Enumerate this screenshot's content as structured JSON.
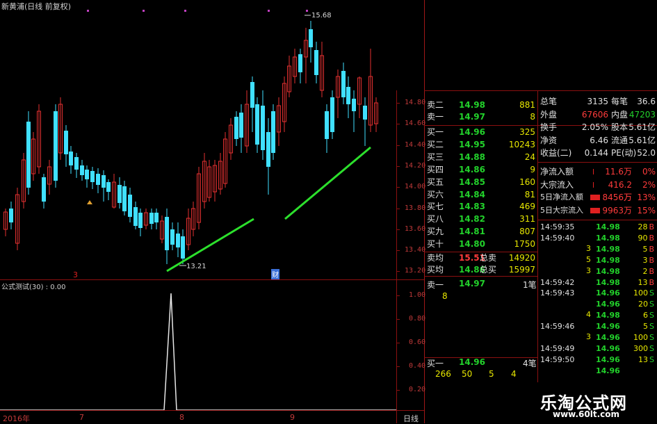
{
  "header": {
    "title": "新黄浦(日线 前复权)",
    "indicator_title": "公式测试(30) : 0.00"
  },
  "chart": {
    "high_label": "15.68",
    "low_label": "13.21",
    "marker_left": "3",
    "marker_mid": "财",
    "price_ticks": [
      "14.80",
      "14.60",
      "14.40",
      "14.20",
      "14.00",
      "13.80",
      "13.60",
      "13.40",
      "13.20"
    ],
    "indicator_ticks": [
      "1.00",
      "0.80",
      "0.60",
      "0.40",
      "0.20"
    ],
    "date_labels": [
      "2016年",
      "7",
      "8",
      "9"
    ],
    "period_label": "日线",
    "colors": {
      "up": "#e23030",
      "down": "#40e0ff",
      "trend": "#2ce02c",
      "grid": "#8c1010"
    }
  },
  "order_book": {
    "sells": [
      {
        "label": "卖二",
        "price": "14.98",
        "volume": "881"
      },
      {
        "label": "卖一",
        "price": "14.97",
        "volume": "8"
      }
    ],
    "buys": [
      {
        "label": "买一",
        "price": "14.96",
        "volume": "325"
      },
      {
        "label": "买二",
        "price": "14.95",
        "volume": "10243"
      },
      {
        "label": "买三",
        "price": "14.88",
        "volume": "24"
      },
      {
        "label": "买四",
        "price": "14.86",
        "volume": "9"
      },
      {
        "label": "买五",
        "price": "14.85",
        "volume": "160"
      },
      {
        "label": "买六",
        "price": "14.84",
        "volume": "81"
      },
      {
        "label": "买七",
        "price": "14.83",
        "volume": "469"
      },
      {
        "label": "买八",
        "price": "14.82",
        "volume": "311"
      },
      {
        "label": "买九",
        "price": "14.81",
        "volume": "807"
      },
      {
        "label": "买十",
        "price": "14.80",
        "volume": "1750"
      }
    ],
    "summary": [
      {
        "label": "卖均",
        "price": "15.51",
        "label2": "总卖",
        "volume": "14920"
      },
      {
        "label": "买均",
        "price": "14.86",
        "label2": "总买",
        "volume": "15997"
      }
    ],
    "sell_one": {
      "label": "卖一",
      "price": "14.97",
      "lots": "1笔",
      "detail": "8"
    },
    "buy_one": {
      "label": "买一",
      "price": "14.96",
      "lots": "4笔",
      "details": [
        "266",
        "50",
        "5",
        "4"
      ]
    }
  },
  "stats": [
    {
      "k1": "总笔",
      "v1": "3135",
      "k2": "每笔",
      "v2": "36.6",
      "c1": "white",
      "c2": "white"
    },
    {
      "k1": "外盘",
      "v1": "67606",
      "k2": "内盘",
      "v2": "47203",
      "c1": "red",
      "c2": "green"
    },
    {
      "k1": "换手",
      "v1": "2.05%",
      "k2": "股本",
      "v2": "5.61亿",
      "c1": "white",
      "c2": "white"
    },
    {
      "k1": "净资",
      "v1": "6.46",
      "k2": "流通",
      "v2": "5.61亿",
      "c1": "white",
      "c2": "white"
    },
    {
      "k1": "收益(二)",
      "v1": "0.144",
      "k2": "PE(动)",
      "v2": "52.0",
      "c1": "white",
      "c2": "white"
    }
  ],
  "fund_flow": [
    {
      "label": "净流入额",
      "value": "11.6万",
      "pct": "0%",
      "bar": 0.08
    },
    {
      "label": "大宗流入",
      "value": "416.2万",
      "pct": "2%",
      "bar": 0.08
    },
    {
      "label": "5日净流入额",
      "value": "8456万",
      "pct": "13%",
      "bar": 1
    },
    {
      "label": "5日大宗流入",
      "value": "9963万",
      "pct": "15%",
      "bar": 1
    }
  ],
  "ticks": [
    {
      "time": "14:59:35",
      "price": "14.98",
      "vol": "28",
      "side": "B"
    },
    {
      "time": "14:59:40",
      "price": "14.98",
      "vol": "90",
      "side": "B"
    },
    {
      "time": "",
      "price": "14.98",
      "vol": "5",
      "side": "B"
    },
    {
      "time": "",
      "price": "14.98",
      "vol": "3",
      "side": "B"
    },
    {
      "time": "",
      "price": "14.98",
      "vol": "2",
      "side": "B"
    },
    {
      "time": "14:59:42",
      "price": "14.98",
      "vol": "13",
      "side": "B"
    },
    {
      "time": "14:59:43",
      "price": "14.96",
      "vol": "100",
      "side": "S"
    },
    {
      "time": "",
      "price": "14.96",
      "vol": "20",
      "side": "S"
    },
    {
      "time": "",
      "price": "14.98",
      "vol": "6",
      "side": "S"
    },
    {
      "time": "14:59:46",
      "price": "14.96",
      "vol": "5",
      "side": "S"
    },
    {
      "time": "",
      "price": "14.96",
      "vol": "100",
      "side": "S"
    },
    {
      "time": "14:59:49",
      "price": "14.96",
      "vol": "300",
      "side": "S"
    },
    {
      "time": "14:59:50",
      "price": "14.96",
      "vol": "13",
      "side": "S"
    },
    {
      "time": "",
      "price": "14.96",
      "vol": "",
      "side": ""
    }
  ],
  "ticks_left_col": [
    "3",
    "5",
    "3",
    "4",
    "3"
  ],
  "watermark": {
    "cn": "乐淘公式网",
    "url": "www.60lt.com"
  }
}
